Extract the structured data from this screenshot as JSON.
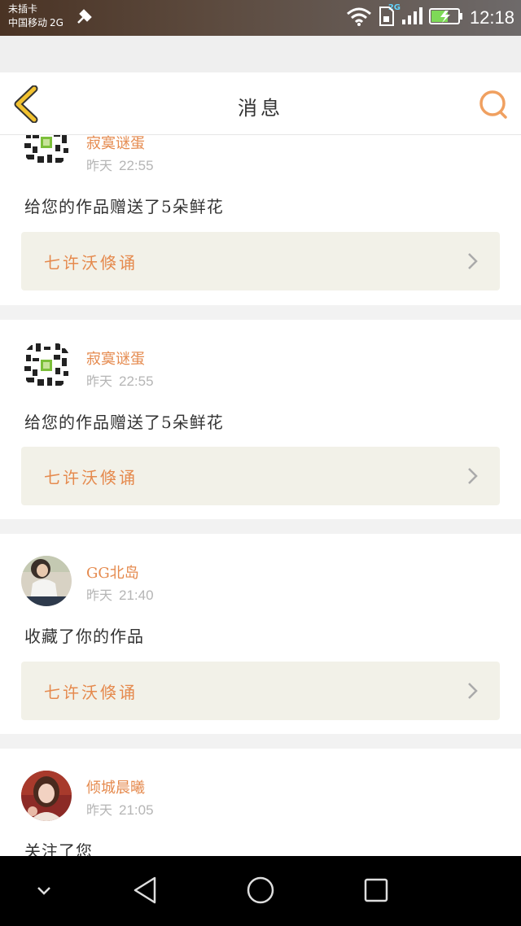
{
  "status_bar": {
    "line1": "未插卡",
    "carrier": "中国移动",
    "network": "2G",
    "signal_badge": "2G",
    "time": "12:18"
  },
  "header": {
    "title": "消息",
    "back_icon": "chevron-left-icon",
    "search_icon": "search-icon"
  },
  "messages": [
    {
      "username": "寂寞谜蛋",
      "day": "昨天",
      "time": "22:55",
      "text": "给您的作品赠送了5朵鲜花",
      "link": "七许沃倏诵"
    },
    {
      "username": "寂寞谜蛋",
      "day": "昨天",
      "time": "22:55",
      "text": "给您的作品赠送了5朵鲜花",
      "link": "七许沃倏诵"
    },
    {
      "username": "GG北岛",
      "day": "昨天",
      "time": "21:40",
      "text": "收藏了你的作品",
      "link": "七许沃倏诵"
    },
    {
      "username": "倾城晨曦",
      "day": "昨天",
      "time": "21:05",
      "text": "关注了您"
    }
  ],
  "colors": {
    "accent": "#e58a4e",
    "back_icon": "#e8b820",
    "link_bg": "#f2f1e8"
  }
}
